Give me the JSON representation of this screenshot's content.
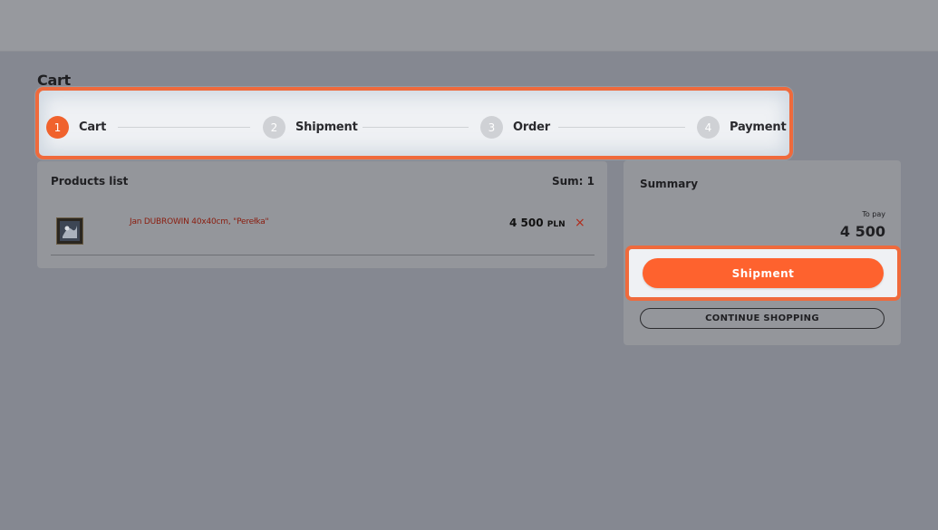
{
  "page": {
    "title": "Cart"
  },
  "stepper": {
    "steps": [
      {
        "number": "1",
        "label": "Cart",
        "active": true
      },
      {
        "number": "2",
        "label": "Shipment",
        "active": false
      },
      {
        "number": "3",
        "label": "Order",
        "active": false
      },
      {
        "number": "4",
        "label": "Payment",
        "active": false
      }
    ],
    "highlight_color": "#ef6a3c",
    "active_color": "#f0622d"
  },
  "products": {
    "title": "Products list",
    "sum": "Sum: 1",
    "items": [
      {
        "name": "Jan DUBROWIN 40x40cm, \"Perełka\"",
        "price": "4 500",
        "currency": "PLN",
        "remove_icon": "×"
      }
    ]
  },
  "summary": {
    "title": "Summary",
    "to_pay_label": "To pay",
    "to_pay_value": "4 500",
    "shipment_button": "Shipment",
    "continue_button": "CONTINUE SHOPPING",
    "button_color": "#fe622e"
  }
}
